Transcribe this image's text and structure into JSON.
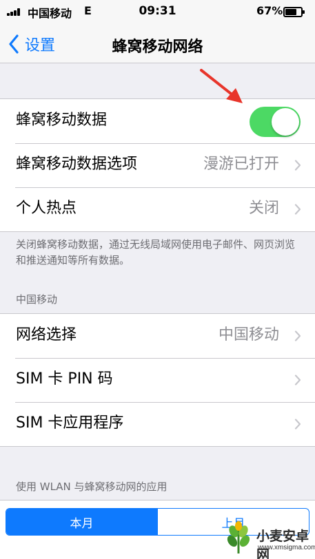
{
  "status_bar": {
    "carrier": "中国移动",
    "network": "E",
    "time": "09:31",
    "battery_percent": "67%",
    "battery_level": 0.67
  },
  "nav": {
    "back_label": "设置",
    "title": "蜂窝移动网络"
  },
  "group1": {
    "cellular_data_label": "蜂窝移动数据",
    "cellular_data_on": true,
    "data_options_label": "蜂窝移动数据选项",
    "data_options_value": "漫游已打开",
    "hotspot_label": "个人热点",
    "hotspot_value": "关闭"
  },
  "footnote": "关闭蜂窝移动数据，通过无线局域网使用电子邮件、网页浏览和推送通知等所有数据。",
  "carrier_section": {
    "header": "中国移动",
    "network_select_label": "网络选择",
    "network_select_value": "中国移动",
    "sim_pin_label": "SIM 卡 PIN 码",
    "sim_apps_label": "SIM 卡应用程序"
  },
  "usage_section": {
    "header": "使用 WLAN 与蜂窝移动网的应用",
    "segments": [
      "本月",
      "上月"
    ],
    "selected_segment": "本月"
  },
  "watermark": {
    "title": "小麦安卓网",
    "url": "www.xmsigma.com"
  },
  "colors": {
    "accent": "#0e7afe",
    "toggle_on": "#4cd964",
    "annotation_arrow": "#e8352b"
  }
}
